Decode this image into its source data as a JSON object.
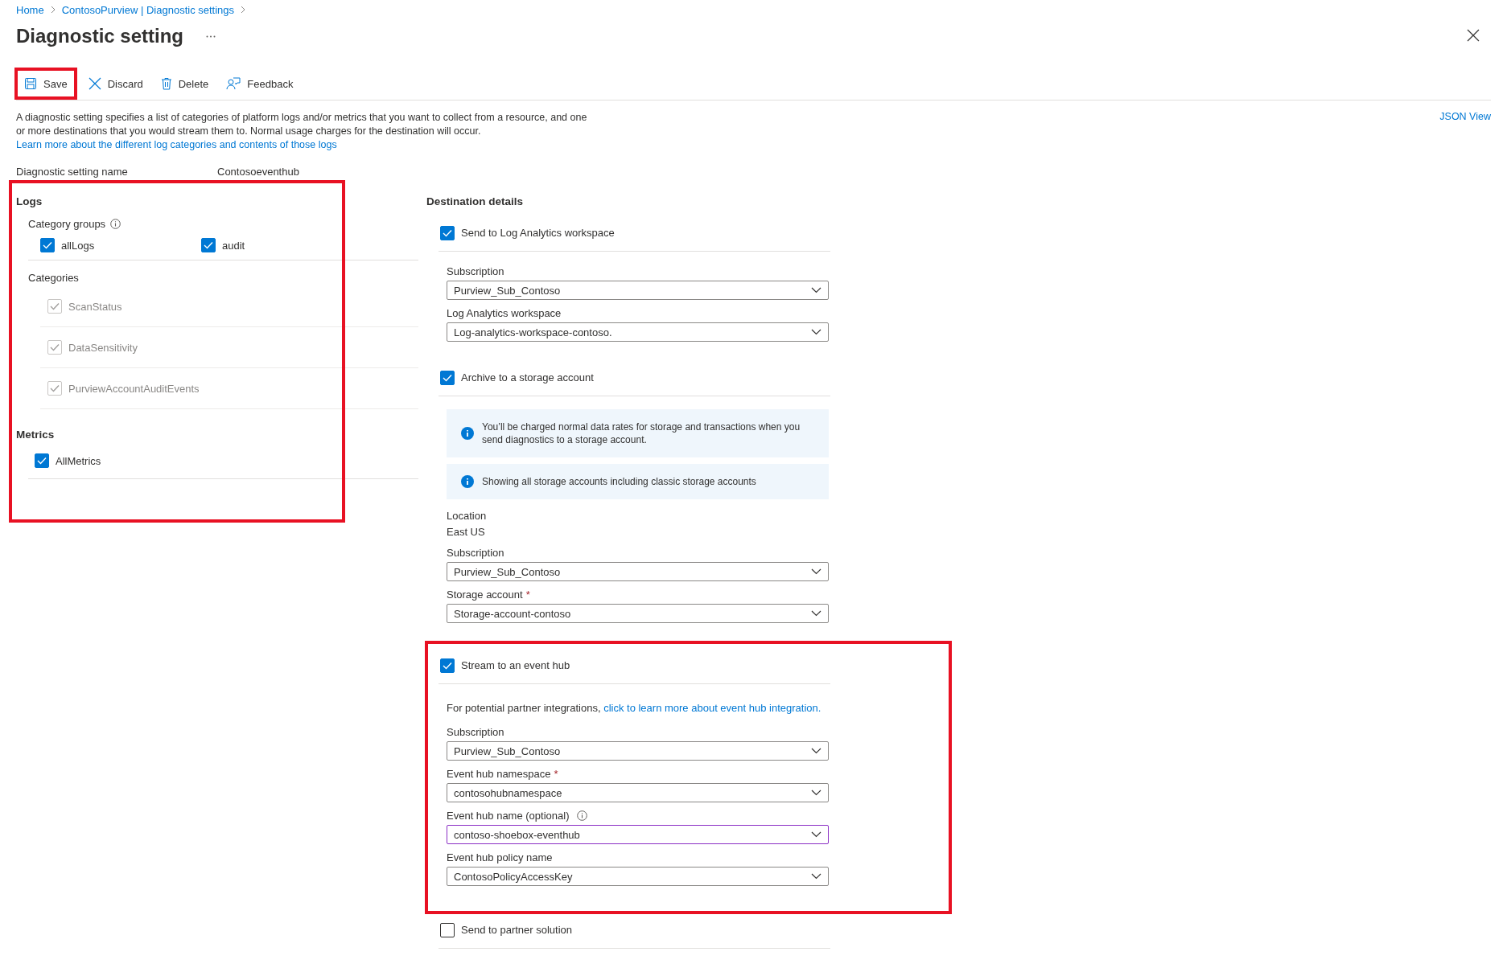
{
  "breadcrumb": [
    {
      "label": "Home"
    },
    {
      "label": "ContosoPurview | Diagnostic settings"
    }
  ],
  "title": "Diagnostic setting",
  "toolbar": [
    {
      "kind": "save",
      "label": "Save",
      "highlighted": true
    },
    {
      "kind": "discard",
      "label": "Discard",
      "highlighted": false
    },
    {
      "kind": "delete",
      "label": "Delete",
      "highlighted": false
    },
    {
      "kind": "feedback",
      "label": "Feedback",
      "highlighted": false
    }
  ],
  "description": {
    "text": "A diagnostic setting specifies a list of categories of platform logs and/or metrics that you want to collect from a resource, and one or more destinations that you would stream them to. Normal usage charges for the destination will occur.",
    "link": "Learn more about the different log categories and contents of those logs"
  },
  "json_view": "JSON View",
  "setting_name": {
    "label": "Diagnostic setting name",
    "value": "Contosoeventhub"
  },
  "left_panel": {
    "highlighted": true,
    "logs": {
      "title": "Logs",
      "category_groups": {
        "label": "Category groups",
        "items": [
          {
            "label": "allLogs",
            "checked": true,
            "disabled": false
          },
          {
            "label": "audit",
            "checked": true,
            "disabled": false
          }
        ]
      },
      "categories": {
        "label": "Categories",
        "items": [
          {
            "label": "ScanStatus",
            "checked": true,
            "disabled": true
          },
          {
            "label": "DataSensitivity",
            "checked": true,
            "disabled": true
          },
          {
            "label": "PurviewAccountAuditEvents",
            "checked": true,
            "disabled": true
          }
        ]
      }
    },
    "metrics": {
      "title": "Metrics",
      "items": [
        {
          "label": "AllMetrics",
          "checked": true,
          "disabled": false
        }
      ]
    }
  },
  "destination": {
    "title": "Destination details",
    "sections": [
      {
        "label": "Send to Log Analytics workspace",
        "checked": true,
        "highlighted": false,
        "items": [
          {
            "kind": "dropdown",
            "label": "Subscription",
            "value": "Purview_Sub_Contoso",
            "info": false,
            "focused": false
          },
          {
            "kind": "dropdown",
            "label": "Log Analytics workspace",
            "value": "Log-analytics-workspace-contoso.",
            "info": false,
            "focused": false
          }
        ]
      },
      {
        "label": "Archive to a storage account",
        "checked": true,
        "highlighted": false,
        "items": [
          {
            "kind": "info",
            "text": "You’ll be charged normal data rates for storage and transactions when you send diagnostics to a storage account."
          },
          {
            "kind": "info",
            "text": "Showing all storage accounts including classic storage accounts"
          },
          {
            "kind": "readonly",
            "label": "Location",
            "value": "East US"
          },
          {
            "kind": "dropdown",
            "label": "Subscription",
            "value": "Purview_Sub_Contoso",
            "info": false,
            "focused": false
          },
          {
            "kind": "dropdown",
            "label": "Storage account",
            "value": "Storage-account-contoso",
            "required": "*",
            "info": false,
            "focused": false
          }
        ]
      },
      {
        "label": "Stream to an event hub",
        "checked": true,
        "highlighted": true,
        "items": [
          {
            "kind": "note",
            "text": "For potential partner integrations,",
            "link": "click to learn more about event hub integration."
          },
          {
            "kind": "dropdown",
            "label": "Subscription",
            "value": "Purview_Sub_Contoso",
            "info": false,
            "focused": false
          },
          {
            "kind": "dropdown",
            "label": "Event hub namespace",
            "value": "contosohubnamespace",
            "required": "*",
            "info": false,
            "focused": false
          },
          {
            "kind": "dropdown",
            "label": "Event hub name (optional)",
            "value": "contoso-shoebox-eventhub",
            "info": true,
            "focused": true
          },
          {
            "kind": "dropdown",
            "label": "Event hub policy name",
            "value": "ContosoPolicyAccessKey",
            "info": false,
            "focused": false
          }
        ]
      },
      {
        "label": "Send to partner solution",
        "checked": false,
        "highlighted": false
      }
    ]
  }
}
